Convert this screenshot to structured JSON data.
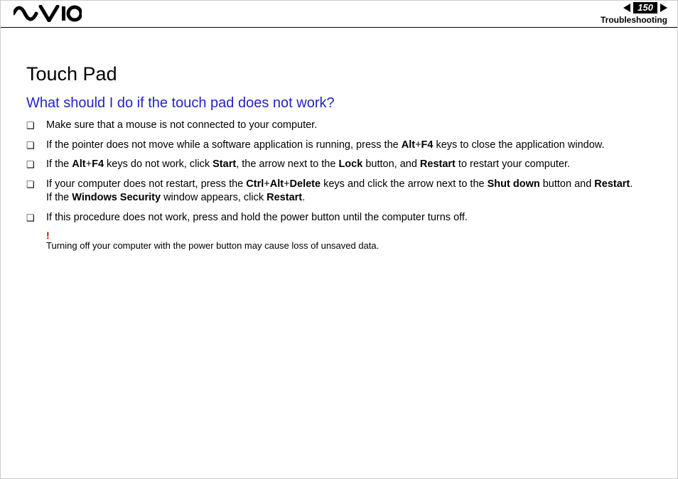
{
  "header": {
    "page_number": "150",
    "section": "Troubleshooting"
  },
  "content": {
    "title": "Touch Pad",
    "question": "What should I do if the touch pad does not work?",
    "bullets": [
      {
        "segments": [
          {
            "t": "Make sure that a mouse is not connected to your computer."
          }
        ]
      },
      {
        "segments": [
          {
            "t": "If the pointer does not move while a software application is running, press the "
          },
          {
            "t": "Alt",
            "b": true
          },
          {
            "t": "+"
          },
          {
            "t": "F4",
            "b": true
          },
          {
            "t": " keys to close the application window."
          }
        ]
      },
      {
        "segments": [
          {
            "t": "If the "
          },
          {
            "t": "Alt",
            "b": true
          },
          {
            "t": "+"
          },
          {
            "t": "F4",
            "b": true
          },
          {
            "t": " keys do not work, click "
          },
          {
            "t": "Start",
            "b": true
          },
          {
            "t": ", the arrow next to the "
          },
          {
            "t": "Lock",
            "b": true
          },
          {
            "t": " button, and "
          },
          {
            "t": "Restart",
            "b": true
          },
          {
            "t": " to restart your computer."
          }
        ]
      },
      {
        "segments": [
          {
            "t": "If your computer does not restart, press the "
          },
          {
            "t": "Ctrl",
            "b": true
          },
          {
            "t": "+"
          },
          {
            "t": "Alt",
            "b": true
          },
          {
            "t": "+"
          },
          {
            "t": "Delete",
            "b": true
          },
          {
            "t": " keys and click the arrow next to the "
          },
          {
            "t": "Shut down",
            "b": true
          },
          {
            "t": " button and "
          },
          {
            "t": "Restart",
            "b": true
          },
          {
            "t": "."
          },
          {
            "br": true
          },
          {
            "t": "If the "
          },
          {
            "t": "Windows Security",
            "b": true
          },
          {
            "t": " window appears, click "
          },
          {
            "t": "Restart",
            "b": true
          },
          {
            "t": "."
          }
        ]
      },
      {
        "segments": [
          {
            "t": "If this procedure does not work, press and hold the power button until the computer turns off."
          }
        ]
      }
    ],
    "warning_mark": "!",
    "warning": "Turning off your computer with the power button may cause loss of unsaved data."
  }
}
